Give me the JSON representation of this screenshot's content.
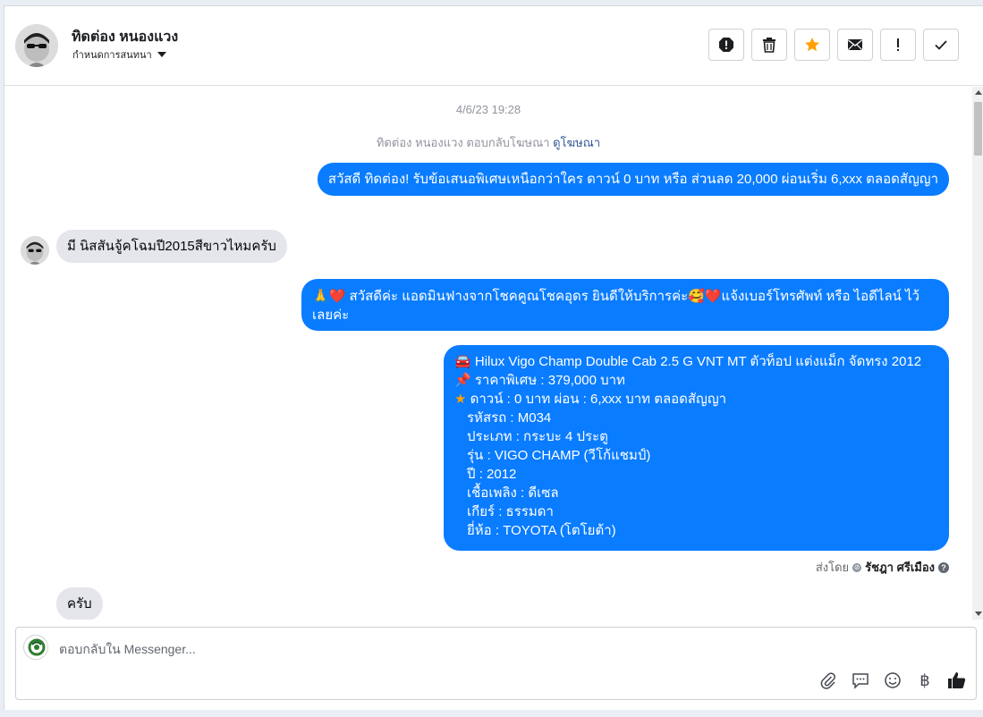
{
  "header": {
    "contact_name": "ทิดต่อง หนองแวง",
    "assign_label": "กำหนดการสนทนา",
    "actions": [
      "spam-icon",
      "trash-icon",
      "star-icon",
      "mail-icon",
      "exclamation-icon",
      "check-icon"
    ],
    "accent_star": "#ff9f00"
  },
  "thread": {
    "timestamp": "4/6/23 19:28",
    "ad_reply_text": "ทิดต่อง หนองแวง ตอบกลับโฆษณา",
    "ad_reply_link": "ดูโฆษณา",
    "messages": {
      "m1": "สวัสดี ทิดต่อง! รับข้อเสนอพิเศษเหนือกว่าใคร ดาวน์ 0 บาท หรือ ส่วนลด 20,000 ผ่อนเริ่ม 6,xxx ตลอดสัญญา",
      "m2": "มี นิสสันจู้คโฉมปี2015สีขาวไหมครับ",
      "m3_emoji": "🙏❤️",
      "m3": "สวัสดีค่ะ แอดมินฟางจากโชคคูณโชคอุดร ยินดีให้บริการค่ะ",
      "m3_emoji2": "🥰❤️",
      "m3_rest": "แจ้งเบอร์โทรศัพท์ หรือ ไอดีไลน์  ไว้เลยค่ะ",
      "m4": {
        "l1": "Hilux Vigo Champ Double Cab 2.5 G VNT MT ตัวท็อป แต่งแม็ก จัดทรง 2012",
        "l2": "ราคาพิเศษ : 379,000 บาท",
        "l3": "ดาวน์ : 0 บาท ผ่อน : 6,xxx บาท ตลอดสัญญา",
        "l4": "รหัสรถ : M034",
        "l5": "ประเภท : กระบะ 4 ประตู",
        "l6": "รุ่น : VIGO CHAMP (วีโก้แชมป์)",
        "l7": "ปี : 2012",
        "l8": "เชื้อเพลิง : ดีเซล",
        "l9": "เกียร์ : ธรรมดา",
        "l10": "ยี่ห้อ : TOYOTA (โตโยต้า)"
      },
      "m5": "ครับ"
    },
    "sent_by_label": "ส่งโดย",
    "sent_by_name": "รัชฎา ศรีเมือง",
    "colors": {
      "outgoing": "#0a7cff",
      "incoming": "#e4e6eb"
    }
  },
  "composer": {
    "placeholder": "ตอบกลับใน Messenger...",
    "tools": [
      "paperclip-icon",
      "chat-icon",
      "emoji-icon",
      "baht-icon",
      "thumbs-up-icon"
    ],
    "baht_symbol": "฿"
  }
}
